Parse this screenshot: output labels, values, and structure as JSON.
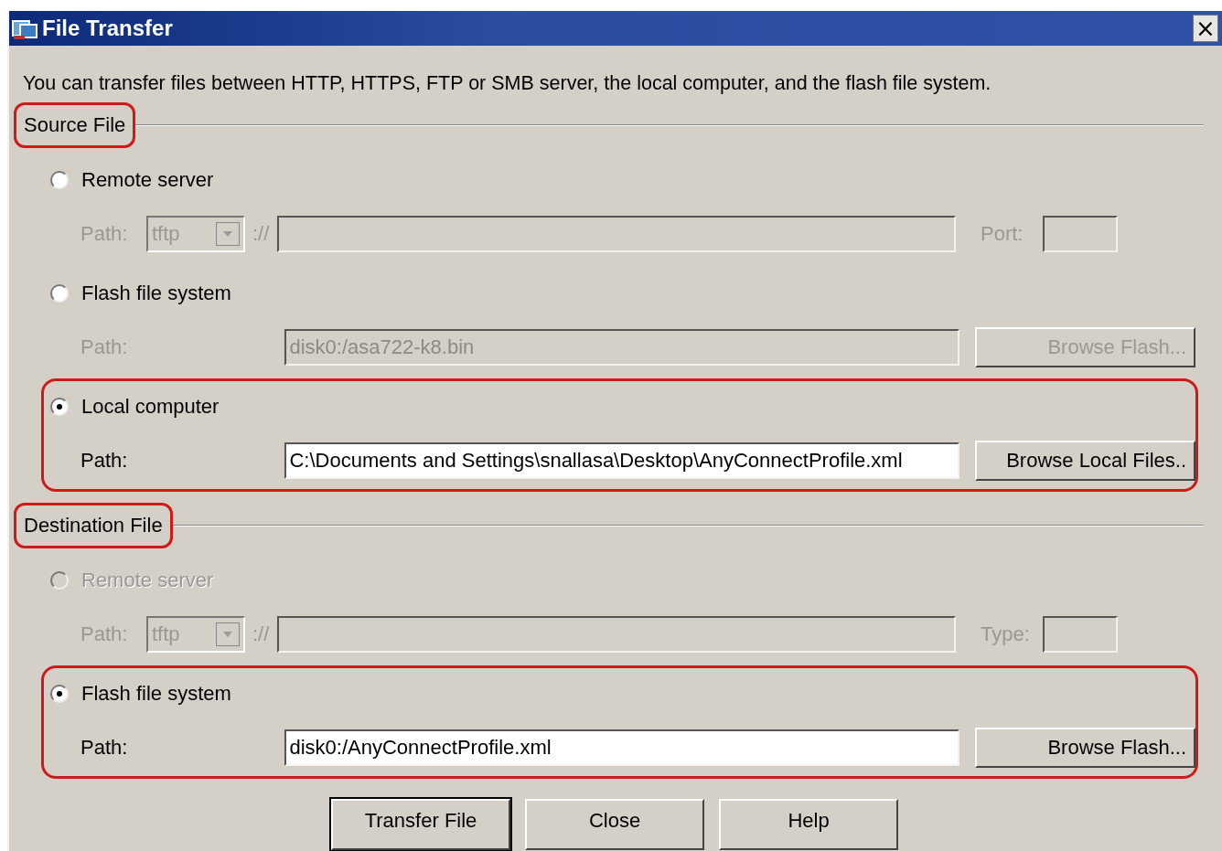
{
  "window": {
    "title": "File Transfer",
    "close": "×"
  },
  "description": "You can transfer files between HTTP, HTTPS, FTP or SMB server, the local computer, and the flash file system.",
  "sections": [
    {
      "title": "Source File",
      "highlighted": true,
      "options": [
        {
          "kind": "remote",
          "label": "Remote server",
          "selected": false,
          "disabled": false,
          "path_label": "Path:",
          "protocol": "tftp",
          "separator": "://",
          "extra_label": "Port:"
        },
        {
          "kind": "browse",
          "label": "Flash file system",
          "selected": false,
          "disabled": false,
          "path_label": "Path:",
          "value": "disk0:/asa722-k8.bin",
          "button": "Browse Flash..."
        },
        {
          "kind": "browse",
          "label": "Local computer",
          "selected": true,
          "disabled": false,
          "highlighted": true,
          "path_label": "Path:",
          "value": "C:\\Documents and Settings\\snallasa\\Desktop\\AnyConnectProfile.xml",
          "button": "Browse Local Files.."
        }
      ]
    },
    {
      "title": "Destination File",
      "highlighted": true,
      "options": [
        {
          "kind": "remote",
          "label": "Remote server",
          "selected": false,
          "disabled": true,
          "path_label": "Path:",
          "protocol": "tftp",
          "separator": "://",
          "extra_label": "Type:"
        },
        {
          "kind": "browse",
          "label": "Flash file system",
          "selected": true,
          "disabled": false,
          "highlighted": true,
          "path_label": "Path:",
          "value": "disk0:/AnyConnectProfile.xml",
          "button": "Browse Flash..."
        }
      ]
    }
  ],
  "buttons": [
    {
      "label": "Transfer File",
      "default": true
    },
    {
      "label": "Close",
      "default": false
    },
    {
      "label": "Help",
      "default": false
    }
  ]
}
